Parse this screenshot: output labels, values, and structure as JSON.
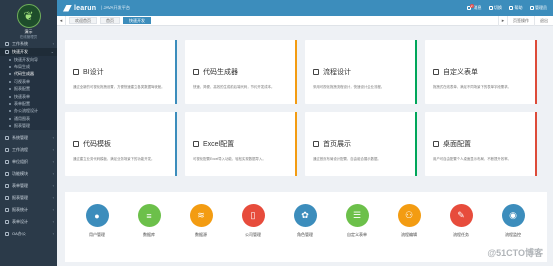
{
  "sidebar": {
    "user_name": "演示",
    "user_org": "在线管理员",
    "items": [
      {
        "label": "工作系统",
        "expanded": false
      },
      {
        "label": "快速开发",
        "expanded": true
      }
    ],
    "sub_items": [
      "快速开发向导",
      "布局生成",
      "代码生成器",
      "可视表单",
      "报表配置",
      "快速表单",
      "表单配置",
      "办公流程设计",
      "通用图表",
      "报表管理"
    ],
    "lower_items": [
      "系统管理",
      "工作流程",
      "单位组织",
      "功能模块",
      "表单管理",
      "报表管理",
      "报表统计",
      "表单设计",
      "OA办公"
    ]
  },
  "topbar": {
    "brand": "learun",
    "subtitle": "| JAVA开发平台",
    "tools": [
      {
        "label": "消息",
        "badge": "2"
      },
      {
        "label": "切换"
      },
      {
        "label": "帮助"
      },
      {
        "label": "管理员"
      }
    ],
    "accent": "#3c8dbc"
  },
  "tabs": {
    "items": [
      "欢迎首页",
      "首页",
      "快速开发"
    ],
    "active_index": 2,
    "tools": [
      "页签操作",
      "退出"
    ]
  },
  "cards": [
    {
      "title": "BI设计",
      "desc": "通过全新的可视化拖拽设置，方便快速建立各类数据驾驶舱。",
      "color": "#3c8dbc",
      "icon": "chart-icon"
    },
    {
      "title": "代码生成器",
      "desc": "快速、简便、高效的生成前后端代码，节约开发成本。",
      "color": "#f39c12",
      "icon": "code-icon"
    },
    {
      "title": "流程设计",
      "desc": "采用可视化拖拽流程设计，快速设计企业流程。",
      "color": "#00a65a",
      "icon": "flow-icon"
    },
    {
      "title": "自定义表单",
      "desc": "拖拽式在线表单，满足不同场景下的表单字段需求。",
      "color": "#dd4b39",
      "icon": "form-icon"
    },
    {
      "title": "代码模板",
      "desc": "通过建立业务代码模板，满足业务场景下的功能开发。",
      "color": "#3c8dbc",
      "icon": "template-icon"
    },
    {
      "title": "Excel配置",
      "desc": "可视化配置Excel导入功能，轻松实现数据导入。",
      "color": "#f39c12",
      "icon": "excel-icon"
    },
    {
      "title": "首页展示",
      "desc": "通过首页布局设计配置，自由组合展示数据。",
      "color": "#00a65a",
      "icon": "home-icon"
    },
    {
      "title": "桌面配置",
      "desc": "用户可自由配置个人桌面显示布局，不断提升效率。",
      "color": "#dd4b39",
      "icon": "desktop-icon"
    }
  ],
  "quick_items": [
    {
      "label": "用户管理",
      "color": "#3c8dbc",
      "icon": "user-icon"
    },
    {
      "label": "数据库",
      "color": "#6cc04a",
      "icon": "database-icon"
    },
    {
      "label": "数据源",
      "color": "#f39c12",
      "icon": "datasource-icon"
    },
    {
      "label": "公司管理",
      "color": "#e74c3c",
      "icon": "company-icon"
    },
    {
      "label": "角色管理",
      "color": "#3c8dbc",
      "icon": "role-icon"
    },
    {
      "label": "自定义表单",
      "color": "#6cc04a",
      "icon": "list-icon"
    },
    {
      "label": "流程编辑",
      "color": "#f39c12",
      "icon": "org-icon"
    },
    {
      "label": "流程任务",
      "color": "#e74c3c",
      "icon": "task-icon"
    },
    {
      "label": "流程监控",
      "color": "#3c8dbc",
      "icon": "eye-icon"
    }
  ],
  "watermark": "@51CTO博客"
}
